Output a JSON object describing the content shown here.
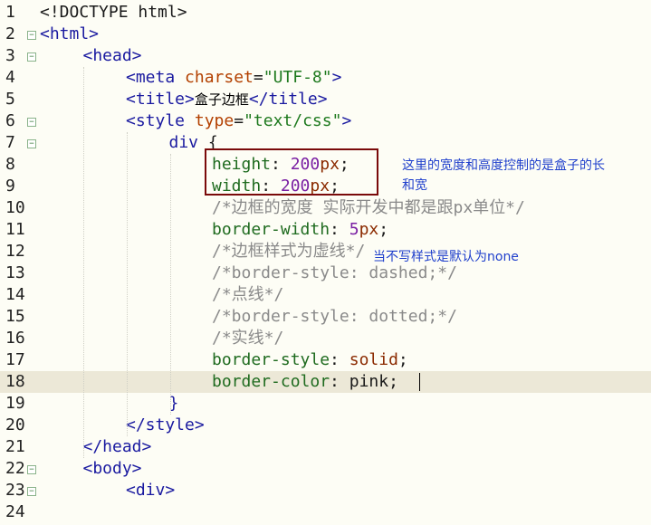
{
  "lines": [
    {
      "n": "1",
      "fold": false,
      "cur": false,
      "indent": 0,
      "tokens": [
        [
          "punc",
          "<!DOCTYPE html>"
        ]
      ]
    },
    {
      "n": "2",
      "fold": true,
      "cur": false,
      "indent": 0,
      "tokens": [
        [
          "tag",
          "<html>"
        ]
      ]
    },
    {
      "n": "3",
      "fold": true,
      "cur": false,
      "indent": 1,
      "tokens": [
        [
          "tag",
          "<head>"
        ]
      ]
    },
    {
      "n": "4",
      "fold": false,
      "cur": false,
      "indent": 2,
      "tokens": [
        [
          "tag",
          "<meta "
        ],
        [
          "attr",
          "charset"
        ],
        [
          "punc",
          "="
        ],
        [
          "str",
          "\"UTF-8\""
        ],
        [
          "tag",
          ">"
        ]
      ]
    },
    {
      "n": "5",
      "fold": false,
      "cur": false,
      "indent": 2,
      "tokens": [
        [
          "tag",
          "<title>"
        ],
        [
          "cjk",
          "盒子边框"
        ],
        [
          "tag",
          "</title>"
        ]
      ]
    },
    {
      "n": "6",
      "fold": true,
      "cur": false,
      "indent": 2,
      "tokens": [
        [
          "tag",
          "<style "
        ],
        [
          "attr",
          "type"
        ],
        [
          "punc",
          "="
        ],
        [
          "str",
          "\"text/css\""
        ],
        [
          "tag",
          ">"
        ]
      ]
    },
    {
      "n": "7",
      "fold": true,
      "cur": false,
      "indent": 3,
      "tokens": [
        [
          "tag",
          "div "
        ],
        [
          "punc",
          "{"
        ]
      ]
    },
    {
      "n": "8",
      "fold": false,
      "cur": false,
      "indent": 4,
      "tokens": [
        [
          "prop",
          "height"
        ],
        [
          "punc",
          ": "
        ],
        [
          "num",
          "200"
        ],
        [
          "kw",
          "px"
        ],
        [
          "punc",
          ";"
        ]
      ]
    },
    {
      "n": "9",
      "fold": false,
      "cur": false,
      "indent": 4,
      "tokens": [
        [
          "prop",
          "width"
        ],
        [
          "punc",
          ": "
        ],
        [
          "num",
          "200"
        ],
        [
          "kw",
          "px"
        ],
        [
          "punc",
          ";"
        ]
      ]
    },
    {
      "n": "10",
      "fold": false,
      "cur": false,
      "indent": 4,
      "tokens": [
        [
          "cmt",
          "/*边框的宽度 实际开发中都是跟px单位*/"
        ]
      ]
    },
    {
      "n": "11",
      "fold": false,
      "cur": false,
      "indent": 4,
      "tokens": [
        [
          "prop",
          "border-width"
        ],
        [
          "punc",
          ": "
        ],
        [
          "num",
          "5"
        ],
        [
          "kw",
          "px"
        ],
        [
          "punc",
          ";"
        ]
      ]
    },
    {
      "n": "12",
      "fold": false,
      "cur": false,
      "indent": 4,
      "tokens": [
        [
          "cmt",
          "/*边框样式为虚线*/"
        ]
      ]
    },
    {
      "n": "13",
      "fold": false,
      "cur": false,
      "indent": 4,
      "tokens": [
        [
          "cmt",
          "/*border-style: dashed;*/"
        ]
      ]
    },
    {
      "n": "14",
      "fold": false,
      "cur": false,
      "indent": 4,
      "tokens": [
        [
          "cmt",
          "/*点线*/"
        ]
      ]
    },
    {
      "n": "15",
      "fold": false,
      "cur": false,
      "indent": 4,
      "tokens": [
        [
          "cmt",
          "/*border-style: dotted;*/"
        ]
      ]
    },
    {
      "n": "16",
      "fold": false,
      "cur": false,
      "indent": 4,
      "tokens": [
        [
          "cmt",
          "/*实线*/"
        ]
      ]
    },
    {
      "n": "17",
      "fold": false,
      "cur": false,
      "indent": 4,
      "tokens": [
        [
          "prop",
          "border-style"
        ],
        [
          "punc",
          ": "
        ],
        [
          "kw",
          "solid"
        ],
        [
          "punc",
          ";"
        ]
      ]
    },
    {
      "n": "18",
      "fold": false,
      "cur": true,
      "indent": 4,
      "tokens": [
        [
          "prop",
          "border-color"
        ],
        [
          "punc",
          ": "
        ],
        [
          "punc",
          "pink;"
        ]
      ]
    },
    {
      "n": "19",
      "fold": false,
      "cur": false,
      "indent": 3,
      "tokens": [
        [
          "tag",
          "}"
        ]
      ]
    },
    {
      "n": "20",
      "fold": false,
      "cur": false,
      "indent": 2,
      "tokens": [
        [
          "tag",
          "</style>"
        ]
      ]
    },
    {
      "n": "21",
      "fold": false,
      "cur": false,
      "indent": 1,
      "tokens": [
        [
          "tag",
          "</head>"
        ]
      ]
    },
    {
      "n": "22",
      "fold": true,
      "cur": false,
      "indent": 1,
      "tokens": [
        [
          "tag",
          "<body>"
        ]
      ]
    },
    {
      "n": "23",
      "fold": true,
      "cur": false,
      "indent": 2,
      "tokens": [
        [
          "tag",
          "<div>"
        ]
      ]
    },
    {
      "n": "24",
      "fold": false,
      "cur": false,
      "indent": 0,
      "tokens": []
    }
  ],
  "notes": {
    "note1_line1": "这里的宽度和高度控制的是盒子的长",
    "note1_line2": "和宽",
    "note2": "当不写样式是默认为none"
  },
  "colors": {
    "background": "#fdfdf5",
    "current_line": "#ece8d7",
    "annotation_box": "#7a0a0a",
    "annotation_text": "#1f3fcc"
  }
}
